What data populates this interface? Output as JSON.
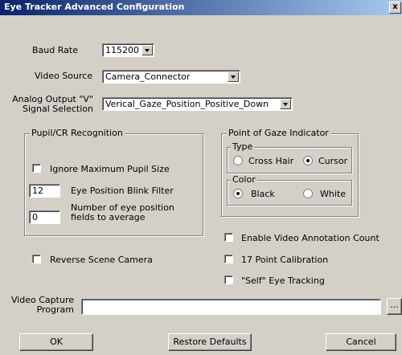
{
  "window": {
    "title": "Eye Tracker Advanced Configuration",
    "close_glyph": "x"
  },
  "baud_rate": {
    "label": "Baud Rate",
    "value": "115200"
  },
  "video_source": {
    "label": "Video Source",
    "value": "Camera_Connector"
  },
  "analog_output": {
    "label_line1": "Analog Output \"V\"",
    "label_line2": "Signal Selection",
    "value": "Verical_Gaze_Position_Positive_Down"
  },
  "pupil_group": {
    "title": "Pupil/CR Recognition",
    "ignore_max_label": "Ignore Maximum Pupil Size",
    "ignore_max_checked": false,
    "blink_filter_value": "12",
    "blink_filter_label": "Eye Position Blink Filter",
    "fields_avg_value": "0",
    "fields_avg_label_line1": "Number of eye position",
    "fields_avg_label_line2": "fields to average"
  },
  "gaze_group": {
    "title": "Point of Gaze Indicator",
    "type_title": "Type",
    "type_options": [
      "Cross Hair",
      "Cursor"
    ],
    "type_selected": "Cursor",
    "color_title": "Color",
    "color_options": [
      "Black",
      "White"
    ],
    "color_selected": "Black"
  },
  "checkboxes": {
    "reverse_scene": "Reverse Scene Camera",
    "video_annotation": "Enable Video Annotation Count",
    "point_calibration": "17 Point Calibration",
    "self_tracking": "\"Self\" Eye Tracking"
  },
  "video_capture": {
    "label_line1": "Video Capture",
    "label_line2": "Program",
    "value": "",
    "browse_label": "..."
  },
  "buttons": {
    "ok": "OK",
    "restore": "Restore Defaults",
    "cancel": "Cancel"
  }
}
